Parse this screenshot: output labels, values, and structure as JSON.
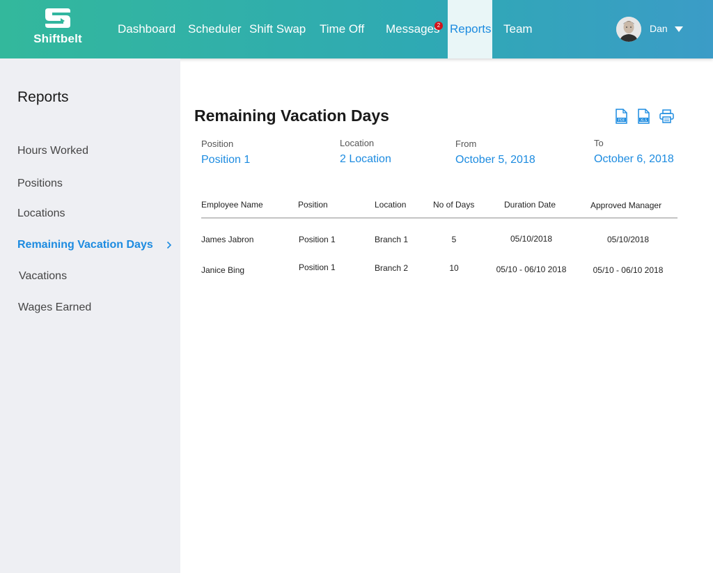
{
  "app": {
    "name": "Shiftbelt",
    "accent": "#1c8be0",
    "header_gradient": [
      "#33b89c",
      "#3b9cc7"
    ]
  },
  "nav": {
    "items": [
      {
        "label": "Dashboard"
      },
      {
        "label": "Scheduler"
      },
      {
        "label": "Shift Swap"
      },
      {
        "label": "Time Off"
      },
      {
        "label": "Messages",
        "badge": "2"
      },
      {
        "label": "Reports",
        "active": true
      },
      {
        "label": "Team"
      }
    ]
  },
  "user": {
    "name": "Dan",
    "icon": "avatar-photo"
  },
  "sidebar": {
    "title": "Reports",
    "items": [
      {
        "label": "Hours Worked"
      },
      {
        "label": "Positions"
      },
      {
        "label": "Locations"
      },
      {
        "label": "Remaining Vacation Days",
        "active": true
      },
      {
        "label": "Vacations"
      },
      {
        "label": "Wages Earned"
      }
    ]
  },
  "report": {
    "title": "Remaining Vacation Days",
    "actions": [
      {
        "icon": "pdf-icon",
        "label": "PDF"
      },
      {
        "icon": "xls-icon",
        "label": "XLS"
      },
      {
        "icon": "print-icon"
      }
    ],
    "filters": [
      {
        "label": "Position",
        "value": "Position 1"
      },
      {
        "label": "Location",
        "value": "2 Location"
      },
      {
        "label": "From",
        "value": "October 5, 2018"
      },
      {
        "label": "To",
        "value": "October 6, 2018"
      }
    ],
    "columns": [
      "Employee Name",
      "Position",
      "Location",
      "No of Days",
      "Duration Date",
      "Approved Manager"
    ],
    "rows": [
      [
        "James Jabron",
        "Position 1",
        "Branch 1",
        "5",
        "05/10/2018",
        "05/10/2018"
      ],
      [
        "Janice Bing",
        "Position 1",
        "Branch 2",
        "10",
        "05/10 - 06/10 2018",
        "05/10 - 06/10 2018"
      ]
    ]
  }
}
